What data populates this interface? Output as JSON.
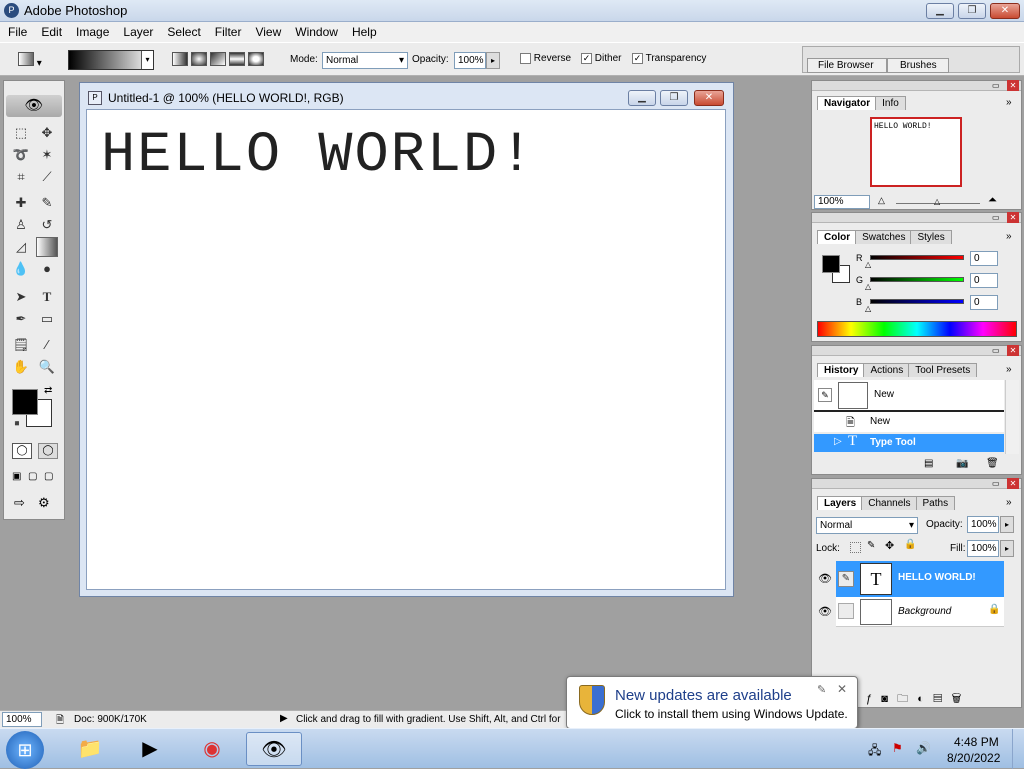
{
  "app": {
    "title": "Adobe Photoshop"
  },
  "menu": [
    "File",
    "Edit",
    "Image",
    "Layer",
    "Select",
    "Filter",
    "View",
    "Window",
    "Help"
  ],
  "options": {
    "mode_label": "Mode:",
    "mode_value": "Normal",
    "opacity_label": "Opacity:",
    "opacity_value": "100%",
    "reverse": "Reverse",
    "dither": "Dither",
    "transparency": "Transparency",
    "file_browser": "File Browser",
    "brushes": "Brushes"
  },
  "document": {
    "title": "Untitled-1 @ 100% (HELLO WORLD!, RGB)",
    "text": "HELLO WORLD!"
  },
  "navigator": {
    "tabs": [
      "Navigator",
      "Info"
    ],
    "thumb_text": "HELLO WORLD!",
    "zoom": "100%"
  },
  "color": {
    "tabs": [
      "Color",
      "Swatches",
      "Styles"
    ],
    "r_label": "R",
    "g_label": "G",
    "b_label": "B",
    "r": "0",
    "g": "0",
    "b": "0",
    "fg": "#000000"
  },
  "history": {
    "tabs": [
      "History",
      "Actions",
      "Tool Presets"
    ],
    "snapshot": "New",
    "items": [
      "New",
      "Type Tool"
    ]
  },
  "layers": {
    "tabs": [
      "Layers",
      "Channels",
      "Paths"
    ],
    "blend": "Normal",
    "opacity_label": "Opacity:",
    "opacity": "100%",
    "lock_label": "Lock:",
    "fill_label": "Fill:",
    "fill": "100%",
    "rows": [
      "HELLO WORLD!",
      "Background"
    ]
  },
  "status": {
    "zoom": "100%",
    "doc": "Doc: 900K/170K",
    "hint": "Click and drag to fill with gradient.  Use Shift, Alt, and Ctrl for"
  },
  "notification": {
    "title": "New updates are available",
    "body": "Click to install them using Windows Update."
  },
  "clock": {
    "time": "4:48 PM",
    "date": "8/20/2022"
  },
  "colors": {
    "selection": "#3399ff",
    "accent_red": "#cc2222"
  }
}
